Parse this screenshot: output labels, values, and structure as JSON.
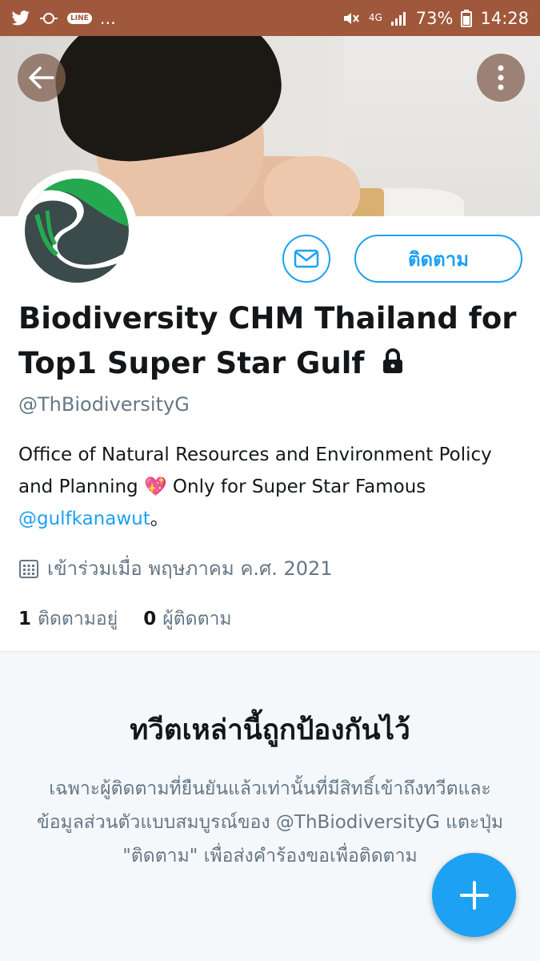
{
  "status_bar": {
    "battery": "73%",
    "time": "14:28",
    "network": "4G",
    "line_badge": "LINE",
    "more": "..."
  },
  "profile": {
    "name_line1": "Biodiversity CHM Thailand for",
    "name_line2": "Top1 Super Star Gulf",
    "handle": "@ThBiodiversityG",
    "bio_part1": "Office of Natural Resources and Environment Policy and Planning",
    "bio_emoji": "💖",
    "bio_part2": " Only for Super Star Famous ",
    "bio_mention": "@gulfkanawut",
    "bio_end": "。",
    "joined": "เข้าร่วมเมื่อ พฤษภาคม ค.ศ. 2021",
    "following_count": "1",
    "following_label": "ติดตามอยู่",
    "followers_count": "0",
    "followers_label": "ผู้ติดตาม"
  },
  "actions": {
    "follow_label": "ติดตาม"
  },
  "protected": {
    "title": "ทวีตเหล่านี้ถูกป้องกันไว้",
    "body": "เฉพาะผู้ติดตามที่ยืนยันแล้วเท่านั้นที่มีสิทธิ์เข้าถึงทวีตและข้อมูลส่วนตัวแบบสมบูรณ์ของ @ThBiodiversityG แตะปุ่ม \"ติดตาม\" เพื่อส่งคำร้องขอเพื่อติดตาม"
  },
  "colors": {
    "accent": "#1da1f2",
    "status_bar": "#a0583c",
    "secondary_text": "#657786"
  }
}
